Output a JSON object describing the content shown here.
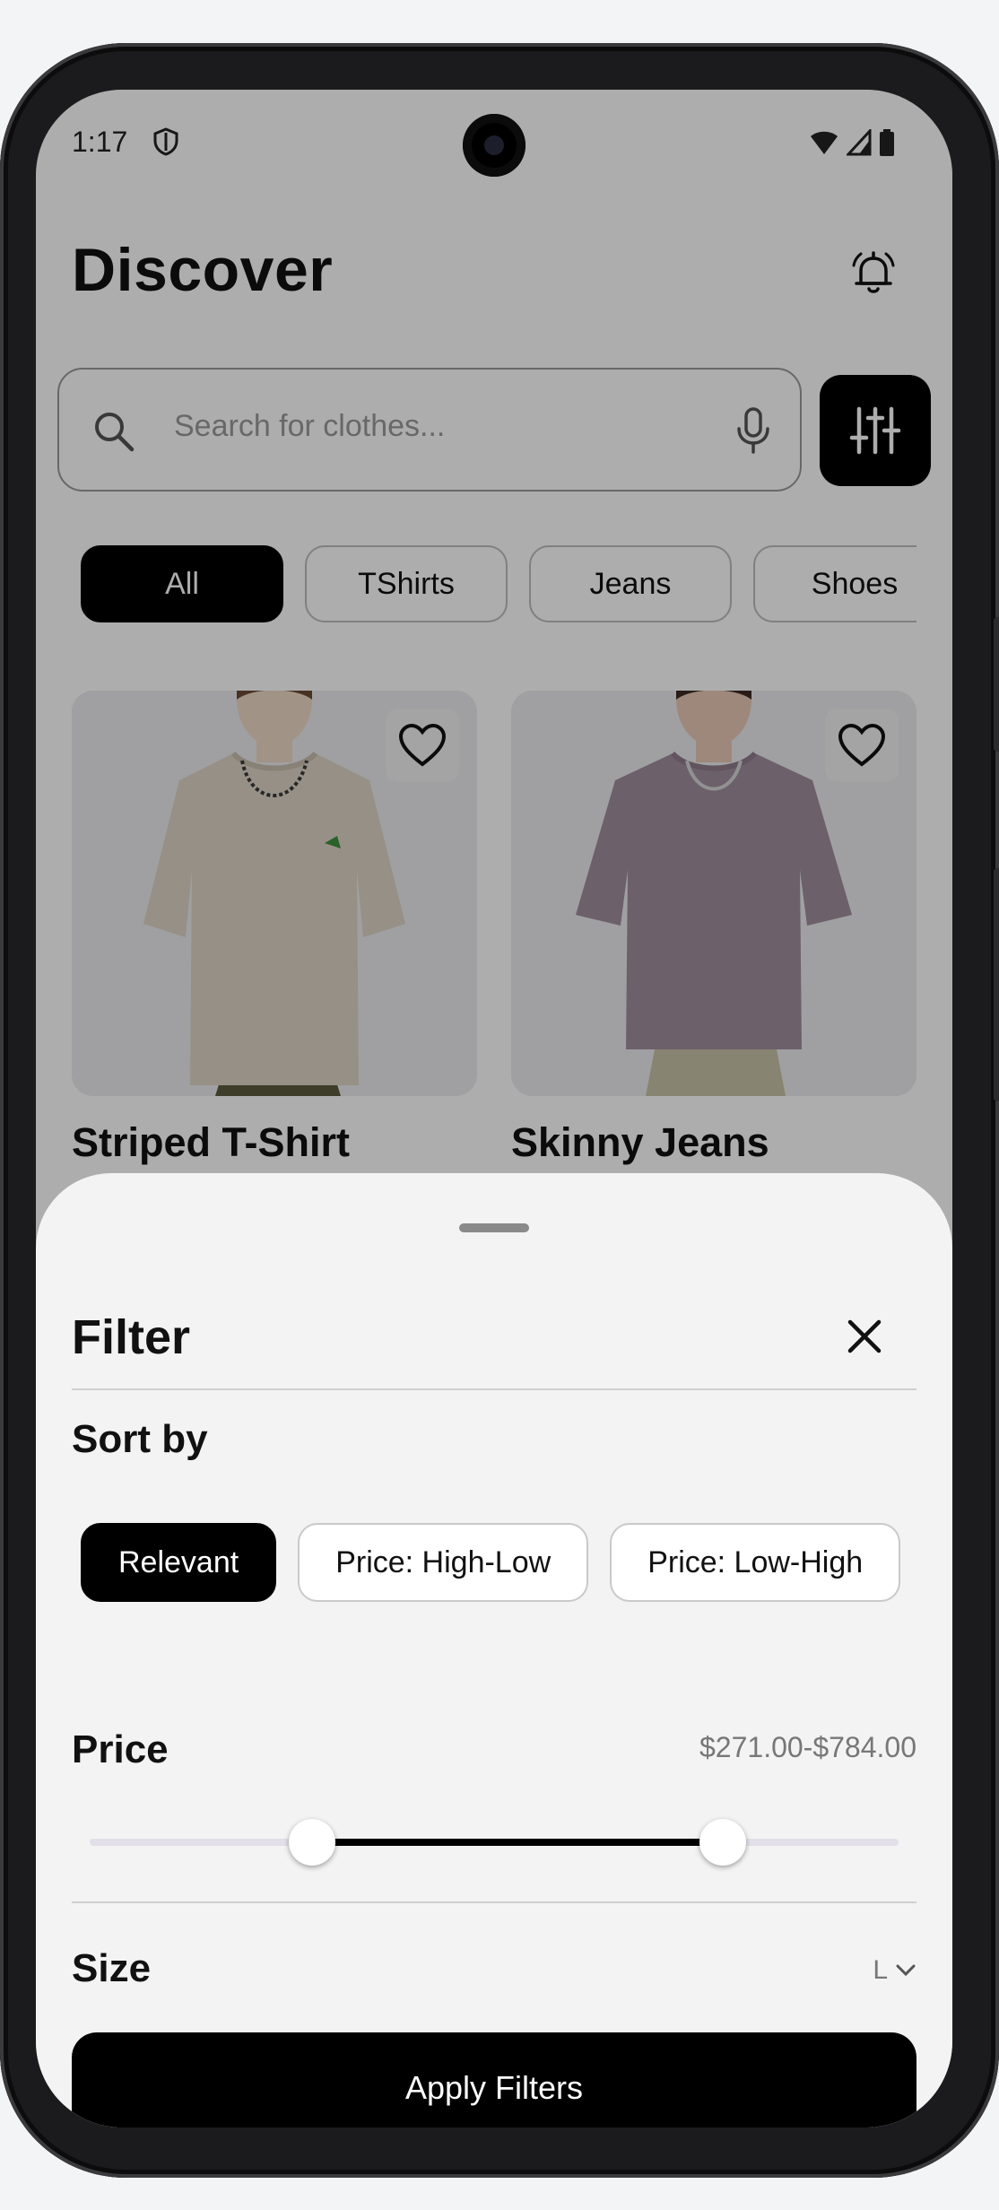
{
  "status_bar": {
    "time": "1:17"
  },
  "header": {
    "title": "Discover"
  },
  "search": {
    "placeholder": "Search for clothes..."
  },
  "categories": [
    "All",
    "TShirts",
    "Jeans",
    "Shoes"
  ],
  "products": [
    {
      "name": "Striped T-Shirt",
      "shirt_color": "#ddd5c6"
    },
    {
      "name": "Skinny Jeans",
      "shirt_color": "#a08e9e"
    }
  ],
  "filter_sheet": {
    "title": "Filter",
    "sort_by_label": "Sort by",
    "sort_options": [
      "Relevant",
      "Price: High-Low",
      "Price: Low-High"
    ],
    "selected_sort": "Relevant",
    "price_label": "Price",
    "price_range_text": "$271.00-$784.00",
    "price_slider": {
      "low_fraction": 0.275,
      "high_fraction": 0.783
    },
    "size_label": "Size",
    "size_value": "L",
    "apply_label": "Apply Filters"
  },
  "colors": {
    "accent": "#000000",
    "sheet_bg": "#f3f3f4"
  }
}
